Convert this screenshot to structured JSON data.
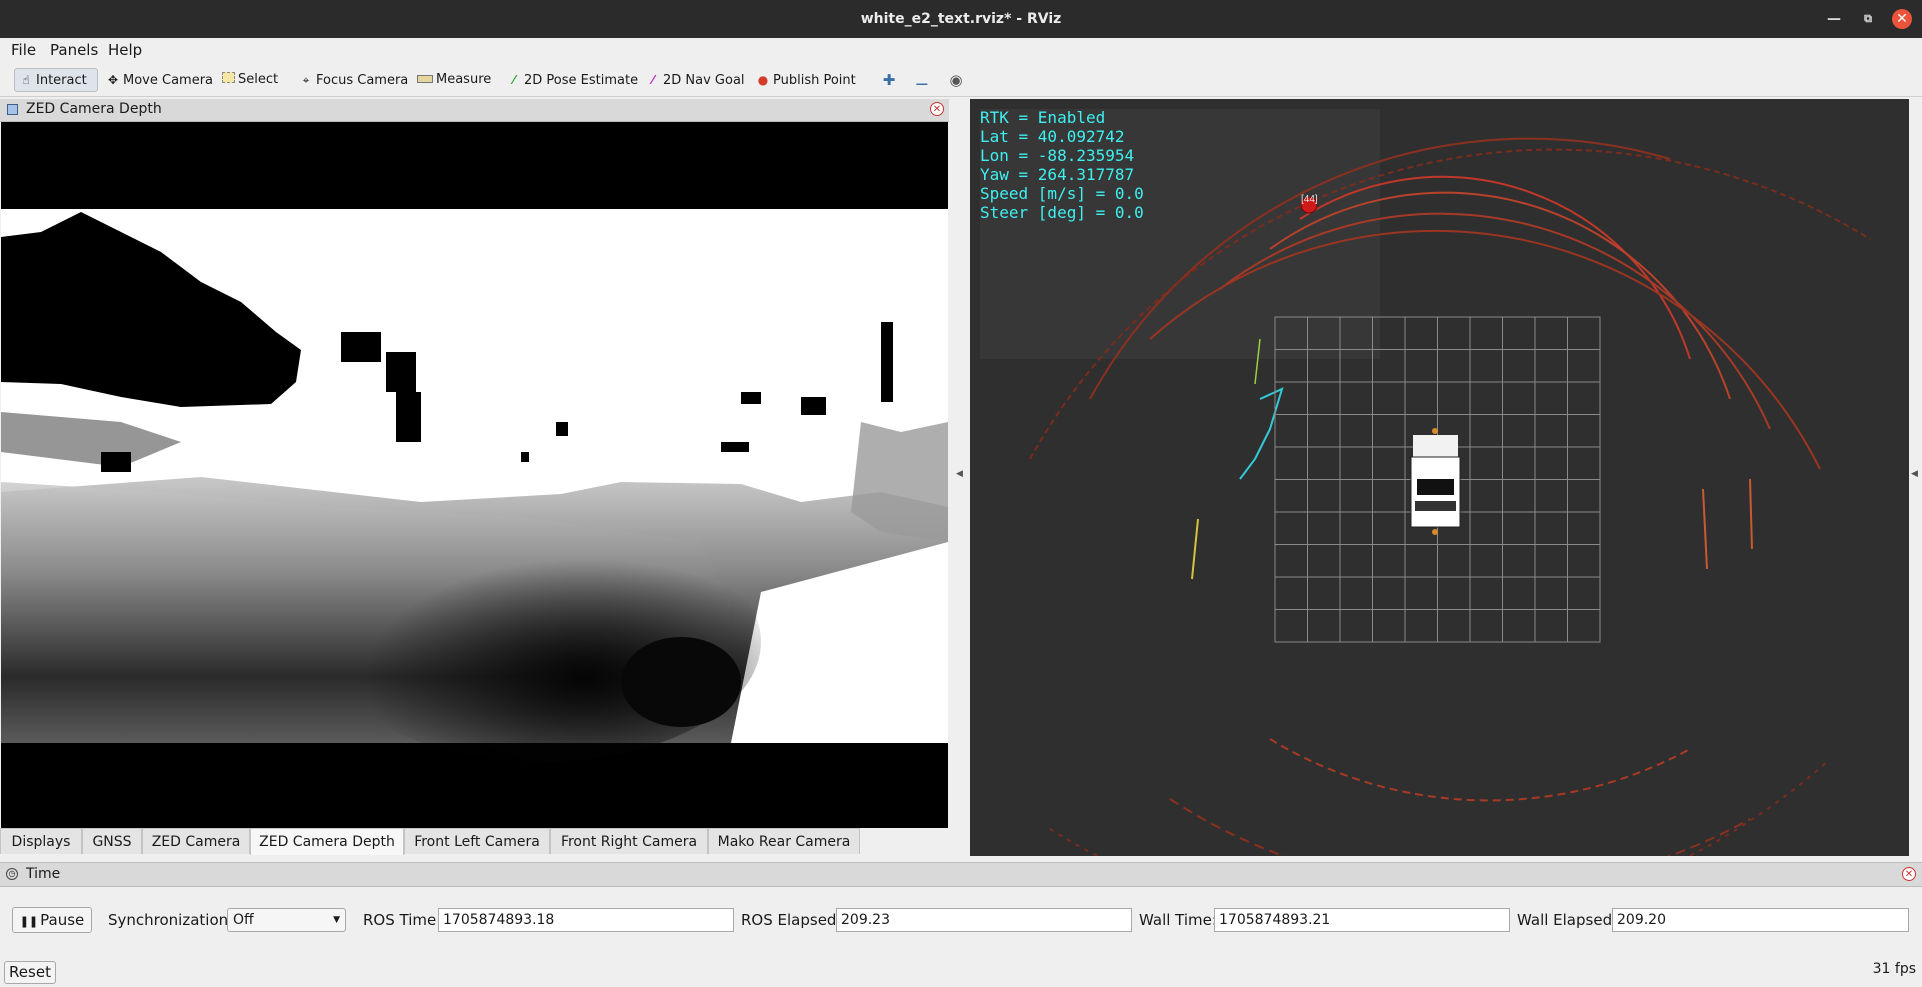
{
  "window": {
    "title": "white_e2_text.rviz* - RViz"
  },
  "menubar": {
    "items": [
      "File",
      "Panels",
      "Help"
    ]
  },
  "toolbar": {
    "tools": [
      "Interact",
      "Move Camera",
      "Select",
      "Focus Camera",
      "Measure",
      "2D Pose Estimate",
      "2D Nav Goal",
      "Publish Point"
    ],
    "active_tool": "Interact"
  },
  "left_panel": {
    "title": "ZED Camera Depth",
    "tabs": [
      "Displays",
      "GNSS",
      "ZED Camera",
      "ZED Camera Depth",
      "Front Left Camera",
      "Front Right Camera",
      "Mako Rear Camera"
    ],
    "active_tab": "ZED Camera Depth"
  },
  "render_view": {
    "hud_lines": [
      "RTK = Enabled",
      "Lat = 40.092742",
      "Lon = -88.235954",
      "Yaw = 264.317787",
      "Speed [m/s] = 0.0",
      "Steer [deg] = 0.0"
    ],
    "marker_label": "[44]",
    "hud_color": "#3ef0f0"
  },
  "time_panel": {
    "title": "Time",
    "pause_label": "Pause",
    "sync_label": "Synchronization:",
    "sync_value": "Off",
    "ros_time_label": "ROS Time:",
    "ros_time_value": "1705874893.18",
    "ros_elapsed_label": "ROS Elapsed:",
    "ros_elapsed_value": "209.23",
    "wall_time_label": "Wall Time:",
    "wall_time_value": "1705874893.21",
    "wall_elapsed_label": "Wall Elapsed:",
    "wall_elapsed_value": "209.20"
  },
  "status": {
    "reset_label": "Reset",
    "fps": "31 fps"
  }
}
